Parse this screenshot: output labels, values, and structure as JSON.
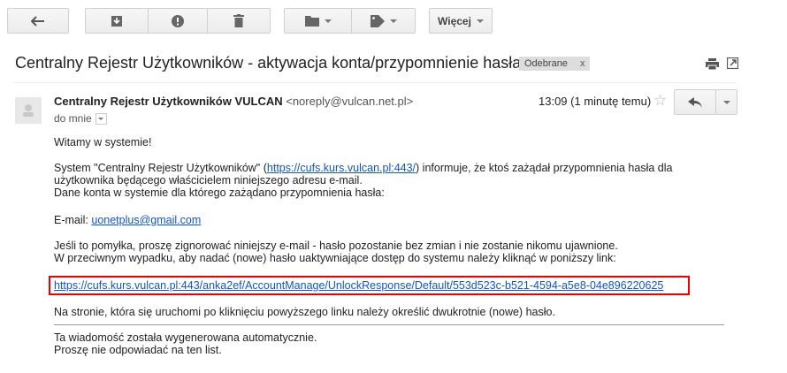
{
  "toolbar": {
    "more_label": "Więcej"
  },
  "email": {
    "subject": "Centralny Rejestr Użytkowników - aktywacja konta/przypomnienie hasła",
    "label": "Odebrane",
    "label_close": "x",
    "sender_name": "Centralny Rejestr Użytkowników VULCAN",
    "sender_email": "<noreply@vulcan.net.pl>",
    "to": "do mnie",
    "time": "13:09 (1 minutę temu)",
    "greeting": "Witamy w systemie!",
    "p1_a": "System \"Centralny Rejestr Użytkowników\" (",
    "p1_link": "https://cufs.kurs.vulcan.pl:443/",
    "p1_b": ") informuje, że ktoś zażądał przypomnienia hasła dla",
    "p1_line2": "użytkownika będącego właścicielem niniejszego adresu e-mail.",
    "p1_line3": "Dane konta w systemie dla którego zażądano przypomnienia hasła:",
    "email_label": "E-mail: ",
    "email_value": "uonetplus@gmail.com",
    "p3_line1": "Jeśli to pomyłka, proszę zignorować niniejszy e-mail - hasło pozostanie bez zmian i nie zostanie nikomu ujawnione.",
    "p3_line2": "W przeciwnym wypadku, aby nadać (nowe) hasło uaktywniające dostęp do systemu należy kliknąć w poniższy link:",
    "reset_link": "https://cufs.kurs.vulcan.pl:443/anka2ef/AccountManage/UnlockResponse/Default/553d523c-b521-4594-a5e8-04e896220625",
    "p4": "Na stronie, która się uruchomi po kliknięciu powyższego linku należy określić dwukrotnie (nowe) hasło.",
    "footer_line1": "Ta wiadomość została wygenerowana automatycznie.",
    "footer_line2": "Proszę nie odpowiadać na ten list."
  },
  "colors": {
    "link": "#1155cc",
    "highlight": "#ee0000"
  }
}
